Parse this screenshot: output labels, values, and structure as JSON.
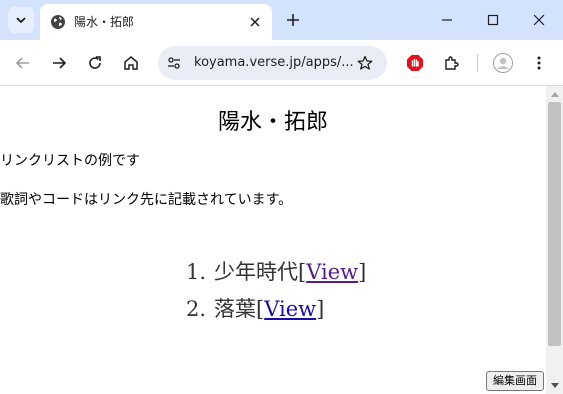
{
  "browser": {
    "tab": {
      "title": "陽水・拓郎"
    },
    "address_bar": {
      "url": "koyama.verse.jp/apps/..."
    }
  },
  "page": {
    "title": "陽水・拓郎",
    "intro": "リンクリストの例です",
    "note": "歌詞やコードはリンク先に記載されています。",
    "songs": [
      {
        "number": "1.",
        "title": "少年時代",
        "link_label": "View",
        "visited": true
      },
      {
        "number": "2.",
        "title": "落葉",
        "link_label": "View",
        "visited": false
      }
    ],
    "edit_button": "編集画面"
  },
  "colors": {
    "tabstrip": "#d3e3fd",
    "omnibox": "#e9eef6",
    "link": "#1a0dab",
    "visited_link": "#551a8b",
    "adblock": "#e8101a"
  }
}
